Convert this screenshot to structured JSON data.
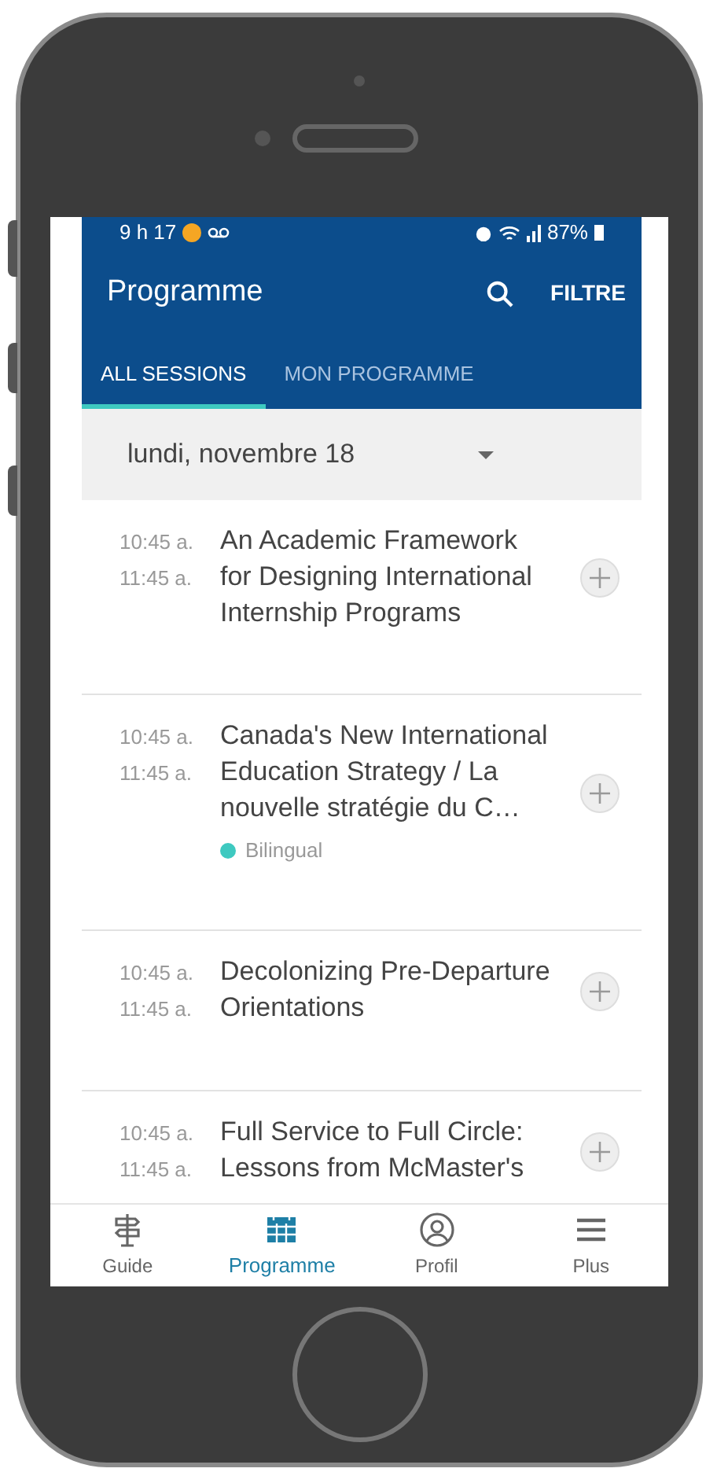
{
  "status_bar": {
    "time": "9 h 17",
    "battery": "87%"
  },
  "app_bar": {
    "title": "Programme",
    "action": "FILTRE"
  },
  "tabs": [
    {
      "label": "ALL SESSIONS",
      "selected": true
    },
    {
      "label": "MON PROGRAMME",
      "selected": false
    }
  ],
  "date_picker": {
    "value": "lundi, novembre 18"
  },
  "sessions": [
    {
      "start": "10:45 a.",
      "end": "11:45 a.",
      "title": "An Academic Framework for Designing International Internship Programs"
    },
    {
      "start": "10:45 a.",
      "end": "11:45 a.",
      "title": "Canada's New International Education Strategy / La nouvelle stratégie du C…",
      "tag": {
        "label": "Bilingual",
        "color": "#3ec9c0"
      }
    },
    {
      "start": "10:45 a.",
      "end": "11:45 a.",
      "title": "Decolonizing Pre-Departure Orientations"
    },
    {
      "start": "10:45 a.",
      "end": "11:45 a.",
      "title": "Full Service to Full Circle: Lessons from McMaster's"
    }
  ],
  "bottom_nav": [
    {
      "label": "Guide",
      "kind": "signpost",
      "selected": false
    },
    {
      "label": "Programme",
      "kind": "calendar",
      "selected": true
    },
    {
      "label": "Profil",
      "kind": "person",
      "selected": false
    },
    {
      "label": "Plus",
      "kind": "menu",
      "selected": false
    }
  ]
}
